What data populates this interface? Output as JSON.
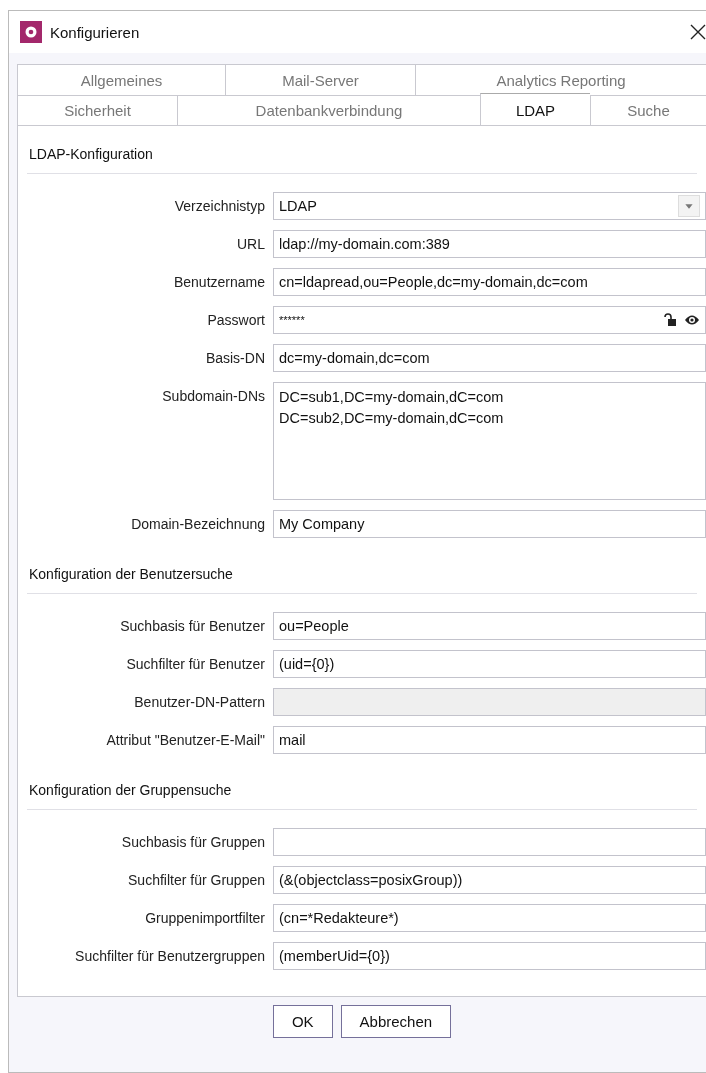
{
  "window": {
    "title": "Konfigurieren"
  },
  "tab_rows": [
    [
      {
        "label": "Allgemeines",
        "selected": false
      },
      {
        "label": "Mail-Server",
        "selected": false
      },
      {
        "label": "Analytics Reporting",
        "selected": false
      }
    ],
    [
      {
        "label": "Sicherheit",
        "selected": false
      },
      {
        "label": "Datenbankverbindung",
        "selected": false
      },
      {
        "label": "LDAP",
        "selected": true
      },
      {
        "label": "Suche",
        "selected": false
      }
    ]
  ],
  "sections": [
    {
      "title": "LDAP-Konfiguration",
      "fields": [
        {
          "kind": "select",
          "label": "Verzeichnistyp",
          "value": "LDAP",
          "disabled": false
        },
        {
          "kind": "text",
          "label": "URL",
          "value": "ldap://my-domain.com:389",
          "disabled": false
        },
        {
          "kind": "text",
          "label": "Benutzername",
          "value": "cn=ldapread,ou=People,dc=my-domain,dc=com",
          "disabled": false
        },
        {
          "kind": "password",
          "label": "Passwort",
          "value": "******",
          "disabled": false
        },
        {
          "kind": "text",
          "label": "Basis-DN",
          "value": "dc=my-domain,dc=com",
          "disabled": false
        },
        {
          "kind": "textarea",
          "label": "Subdomain-DNs",
          "value": "DC=sub1,DC=my-domain,dC=com\nDC=sub2,DC=my-domain,dC=com",
          "disabled": false
        },
        {
          "kind": "text",
          "label": "Domain-Bezeichnung",
          "value": "My Company",
          "disabled": false
        }
      ]
    },
    {
      "title": "Konfiguration der Benutzersuche",
      "fields": [
        {
          "kind": "text",
          "label": "Suchbasis für Benutzer",
          "value": "ou=People",
          "disabled": false
        },
        {
          "kind": "text",
          "label": "Suchfilter für Benutzer",
          "value": "(uid={0})",
          "disabled": false
        },
        {
          "kind": "text",
          "label": "Benutzer-DN-Pattern",
          "disabled": true
        },
        {
          "kind": "text",
          "label": "Attribut \"Benutzer-E-Mail\"",
          "value": "mail",
          "disabled": false
        }
      ]
    },
    {
      "title": "Konfiguration der Gruppensuche",
      "fields": [
        {
          "kind": "text",
          "label": "Suchbasis für Gruppen",
          "disabled": false
        },
        {
          "kind": "text",
          "label": "Suchfilter für Gruppen",
          "value": "(&(objectclass=posixGroup))",
          "disabled": false
        },
        {
          "kind": "text",
          "label": "Gruppenimportfilter",
          "value": "(cn=*Redakteure*)",
          "disabled": false
        },
        {
          "kind": "text",
          "label": "Suchfilter für Benutzergruppen",
          "value": "(memberUid={0})",
          "disabled": false
        }
      ]
    }
  ],
  "buttons": [
    "OK",
    "Abbrechen"
  ]
}
